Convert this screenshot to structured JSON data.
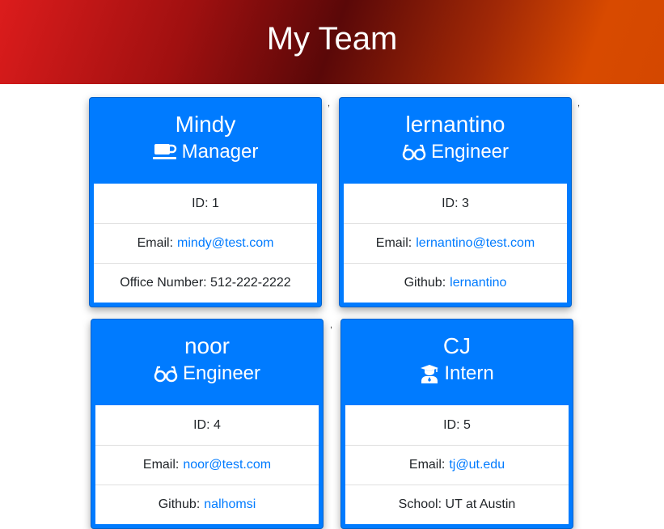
{
  "header": {
    "title": "My Team"
  },
  "separator": ",",
  "cards": [
    {
      "name": "Mindy",
      "role": "Manager",
      "role_icon": "coffee-mug-icon",
      "id_text": "ID: 1",
      "email_label": "Email:",
      "email": "mindy@test.com",
      "extra_label": "Office Number: 512-222-2222",
      "extra_value": ""
    },
    {
      "name": "lernantino",
      "role": "Engineer",
      "role_icon": "glasses-icon",
      "id_text": "ID: 3",
      "email_label": "Email:",
      "email": "lernantino@test.com",
      "extra_label": "Github:",
      "extra_value": "lernantino"
    },
    {
      "name": "noor",
      "role": "Engineer",
      "role_icon": "glasses-icon",
      "id_text": "ID: 4",
      "email_label": "Email:",
      "email": "noor@test.com",
      "extra_label": "Github:",
      "extra_value": "nalhomsi"
    },
    {
      "name": "CJ",
      "role": "Intern",
      "role_icon": "graduate-icon",
      "id_text": "ID: 5",
      "email_label": "Email:",
      "email": "tj@ut.edu",
      "extra_label": "School: UT at Austin",
      "extra_value": ""
    }
  ]
}
